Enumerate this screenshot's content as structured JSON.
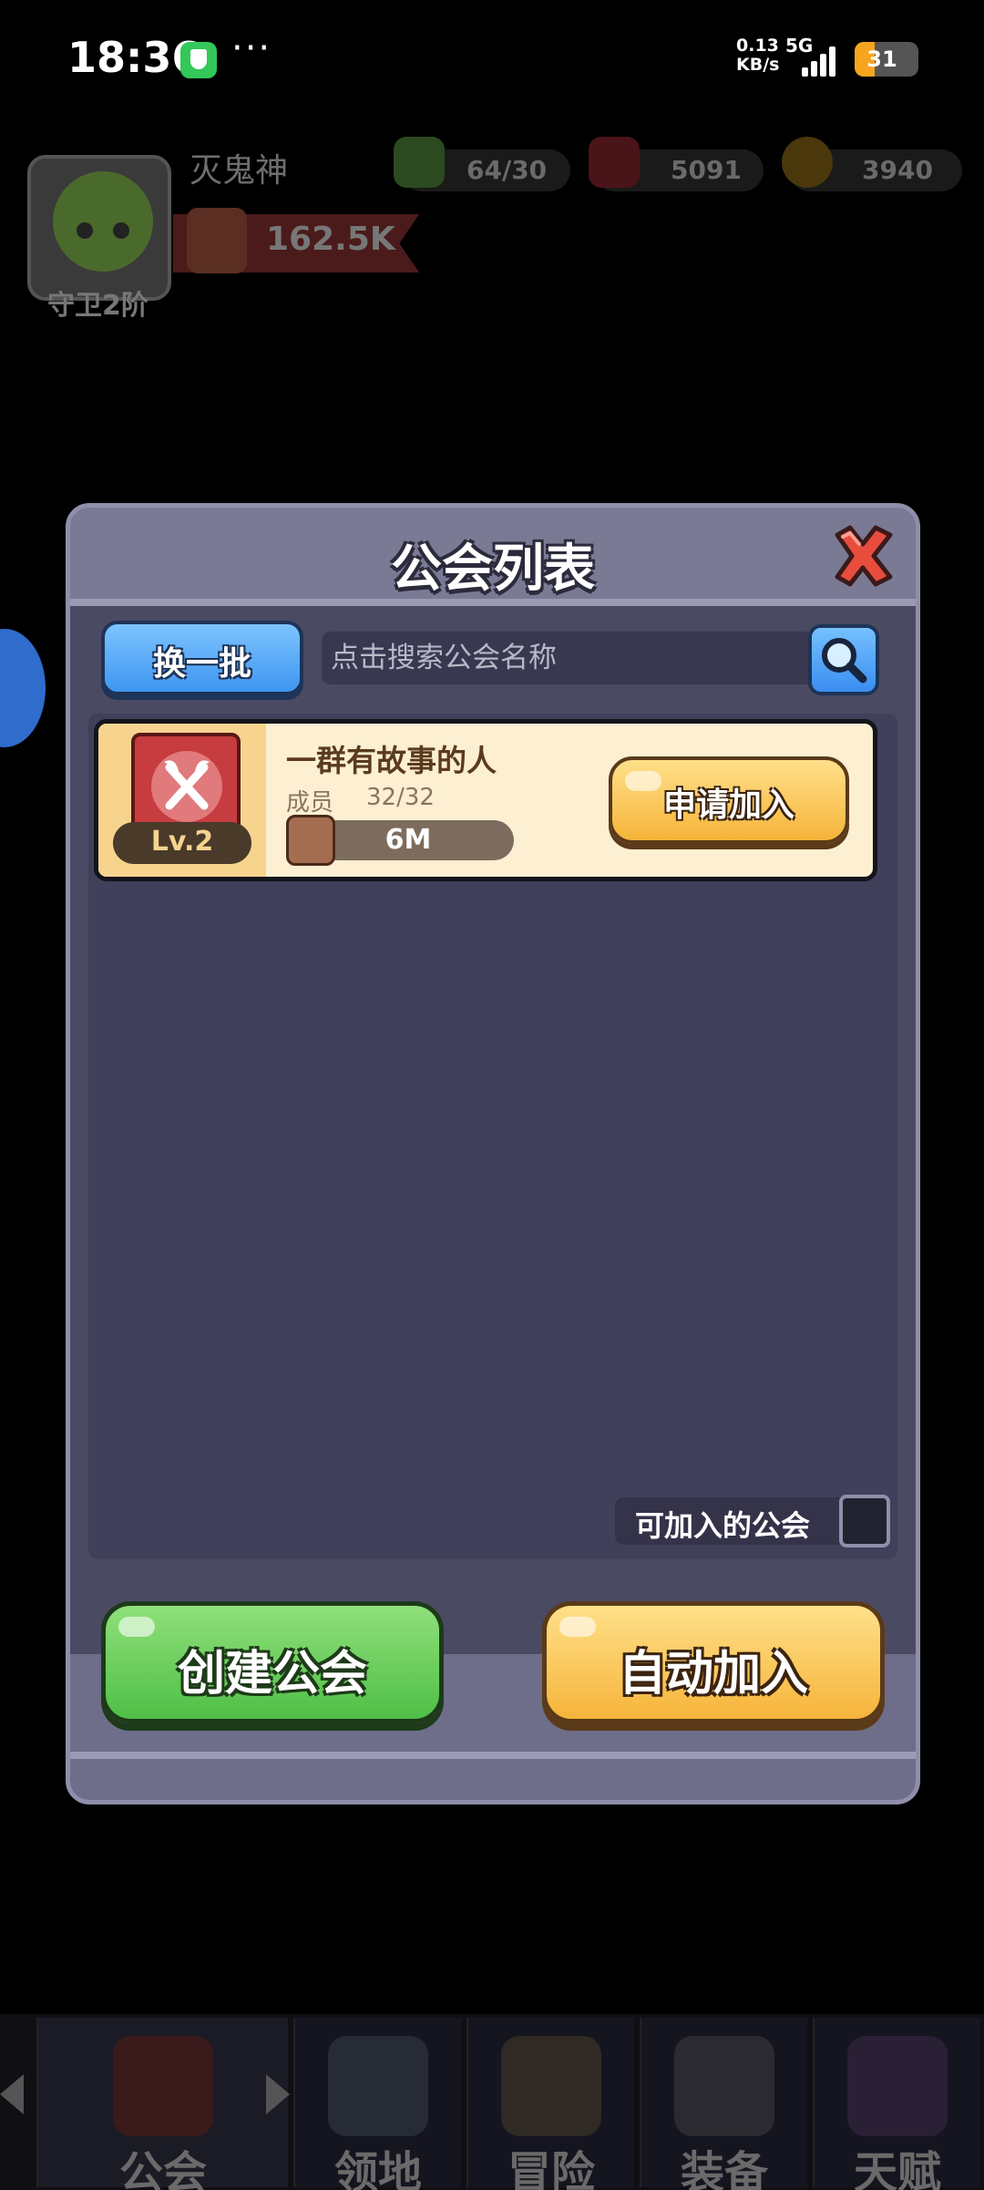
{
  "status_bar": {
    "time": "18:36",
    "more": "···",
    "net_speed_value": "0.13",
    "net_speed_unit": "KB/s",
    "network": "5G",
    "battery": "31",
    "battery_level": 0.31
  },
  "hud": {
    "player_name": "灭鬼神",
    "rank_label": "守卫2阶",
    "power": "162.5K",
    "resources": [
      {
        "icon": "green-energy-icon",
        "value": "64/30",
        "color": "#3a7a2a"
      },
      {
        "icon": "red-gem-icon",
        "value": "5091",
        "color": "#7a1e22"
      },
      {
        "icon": "gold-coin-icon",
        "value": "3940",
        "color": "#7a5a10"
      }
    ]
  },
  "modal": {
    "title": "公会列表",
    "swap_button": "换一批",
    "search_placeholder": "点击搜索公会名称",
    "filter_label": "可加入的公会",
    "create_button": "创建公会",
    "auto_join_button": "自动加入"
  },
  "guilds": [
    {
      "name": "一群有故事的人",
      "level": "Lv.2",
      "members_label": "成员",
      "members": "32/32",
      "power": "6M",
      "apply_label": "申请加入"
    }
  ],
  "bottom_nav": [
    {
      "label": "公会",
      "icon": "guild-icon",
      "active": true
    },
    {
      "label": "领地",
      "icon": "castle-icon",
      "active": false
    },
    {
      "label": "冒险",
      "icon": "crossed-axes-icon",
      "active": false
    },
    {
      "label": "装备",
      "icon": "helmet-icon",
      "active": false
    },
    {
      "label": "天赋",
      "icon": "talent-book-icon",
      "active": false
    }
  ],
  "colors": {
    "modal_bg": "#6e6e8a",
    "panel_bg": "#41405a",
    "accent_blue": "#3f96f0",
    "accent_green": "#4fbf46",
    "accent_yellow": "#f6b43a",
    "close_red": "#e84c3d"
  }
}
